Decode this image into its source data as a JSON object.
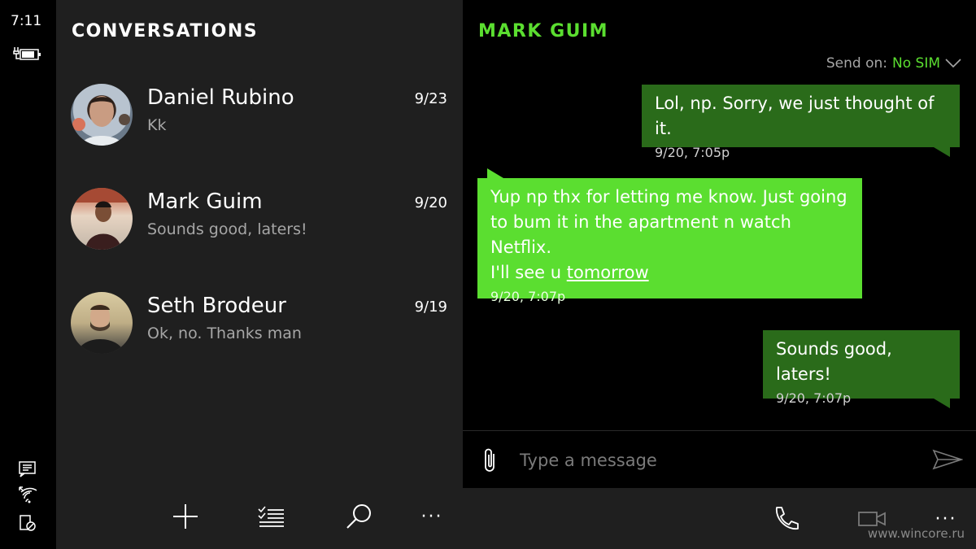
{
  "status_bar": {
    "time": "7:11"
  },
  "conversations": {
    "title": "CONVERSATIONS",
    "items": [
      {
        "name": "Daniel Rubino",
        "preview": "Kk",
        "date": "9/23"
      },
      {
        "name": "Mark Guim",
        "preview": "Sounds good, laters!",
        "date": "9/20"
      },
      {
        "name": "Seth Brodeur",
        "preview": "Ok, no. Thanks man",
        "date": "9/19"
      }
    ],
    "appbar": {
      "more": "···"
    }
  },
  "chat": {
    "title": "MARK GUIM",
    "send_on_label": "Send on:",
    "send_on_value": "No SIM",
    "messages": [
      {
        "direction": "out",
        "text": "Lol, np. Sorry, we just thought of it.",
        "time": "9/20, 7:05p"
      },
      {
        "direction": "in",
        "text_part1": "Yup np thx for letting me know. Just going\nto bum it in the apartment n watch Netflix.\nI'll see u ",
        "link_text": "tomorrow",
        "time": "9/20, 7:07p"
      },
      {
        "direction": "out",
        "text": "Sounds good, laters!",
        "time": "9/20, 7:07p"
      }
    ],
    "composer": {
      "placeholder": "Type a message"
    },
    "appbar": {
      "more": "···"
    },
    "watermark": "www.wincore.ru"
  },
  "colors": {
    "accent": "#5bde30",
    "outgoing_bubble": "#2a6b1a",
    "pane_bg": "#1f1f1f"
  }
}
